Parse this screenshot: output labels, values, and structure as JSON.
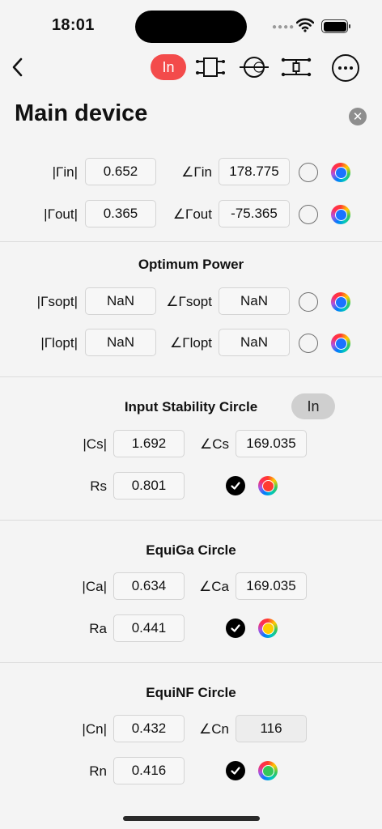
{
  "status_bar": {
    "time": "18:01"
  },
  "nav": {
    "in_label": "In"
  },
  "page": {
    "title": "Main device"
  },
  "reflection": [
    {
      "mag_label": "|Γin|",
      "mag_value": "0.652",
      "ang_label": "∠Γin",
      "ang_value": "178.775",
      "color": "#1a73ff"
    },
    {
      "mag_label": "|Γout|",
      "mag_value": "0.365",
      "ang_label": "∠Γout",
      "ang_value": "-75.365",
      "color": "#1a73ff"
    }
  ],
  "optimum_power": {
    "title": "Optimum Power",
    "rows": [
      {
        "mag_label": "|Γsopt|",
        "mag_value": "NaN",
        "ang_label": "∠Γsopt",
        "ang_value": "NaN",
        "color": "#1a73ff"
      },
      {
        "mag_label": "|Γlopt|",
        "mag_value": "NaN",
        "ang_label": "∠Γlopt",
        "ang_value": "NaN",
        "color": "#1a73ff"
      }
    ]
  },
  "input_stability": {
    "title": "Input Stability Circle",
    "toggle_label": "In",
    "mag_label": "|Cs|",
    "mag_value": "1.692",
    "ang_label": "∠Cs",
    "ang_value": "169.035",
    "r_label": "Rs",
    "r_value": "0.801",
    "color": "#ff3b30"
  },
  "equiga": {
    "title": "EquiGa Circle",
    "mag_label": "|Ca|",
    "mag_value": "0.634",
    "ang_label": "∠Ca",
    "ang_value": "169.035",
    "r_label": "Ra",
    "r_value": "0.441",
    "color": "#ffcc00"
  },
  "equinf": {
    "title": "EquiNF Circle",
    "mag_label": "|Cn|",
    "mag_value": "0.432",
    "ang_label": "∠Cn",
    "ang_value": "116",
    "r_label": "Rn",
    "r_value": "0.416",
    "color": "#34c759"
  }
}
